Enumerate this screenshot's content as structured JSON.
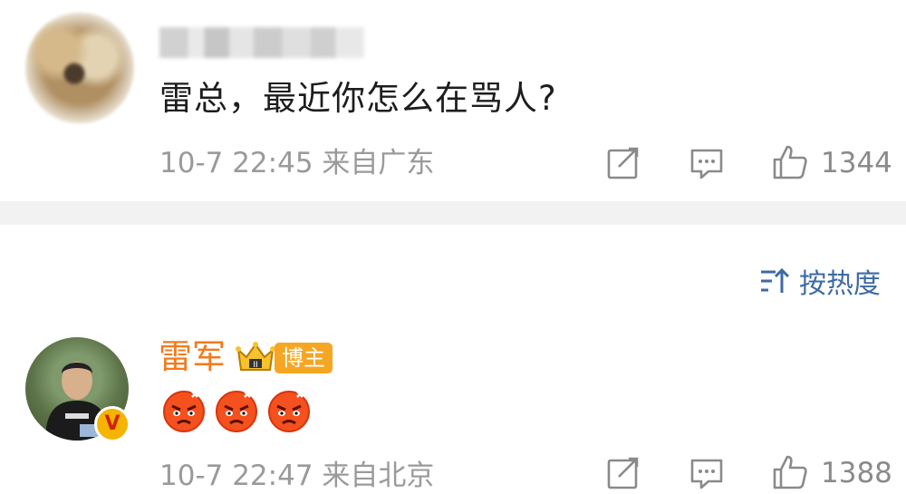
{
  "comment1": {
    "text": "雷总，最近你怎么在骂人?",
    "time": "10-7 22:45",
    "location": "来自广东",
    "like_count": "1344"
  },
  "sort": {
    "label": "按热度",
    "icon": "sort-icon"
  },
  "comment2": {
    "username": "雷军",
    "badge": "博主",
    "emoji_icon": "angry-face-icon",
    "emoji_count": 3,
    "time": "10-7 22:47",
    "location": "来自北京",
    "like_count": "1388"
  },
  "colors": {
    "username": "#f27a1f",
    "sort": "#3d6aa6",
    "meta": "#9a9a9a",
    "separator": "#f2f2f2",
    "badge": "#f5a623"
  }
}
